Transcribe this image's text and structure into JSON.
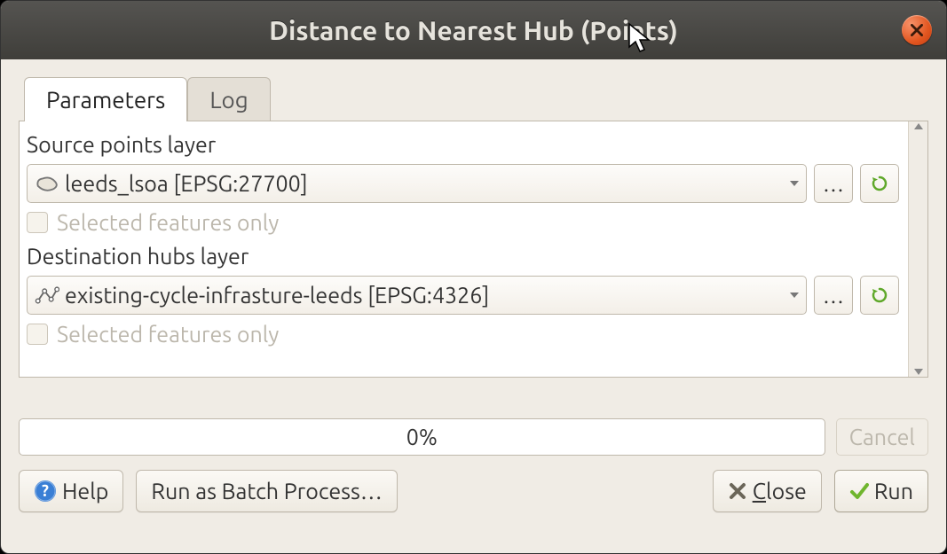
{
  "window": {
    "title": "Distance to Nearest Hub (Points)"
  },
  "tabs": {
    "parameters": "Parameters",
    "log": "Log"
  },
  "fields": {
    "source_label": "Source points layer",
    "source_value": "leeds_lsoa [EPSG:27700]",
    "dest_label": "Destination hubs layer",
    "dest_value": "existing-cycle-infrasture-leeds [EPSG:4326]",
    "selected_only": "Selected features only",
    "browse_label": "…"
  },
  "progress": {
    "text": "0%",
    "cancel": "Cancel"
  },
  "buttons": {
    "help": "Help",
    "batch": "Run as Batch Process…",
    "close": "Close",
    "run": "Run"
  }
}
